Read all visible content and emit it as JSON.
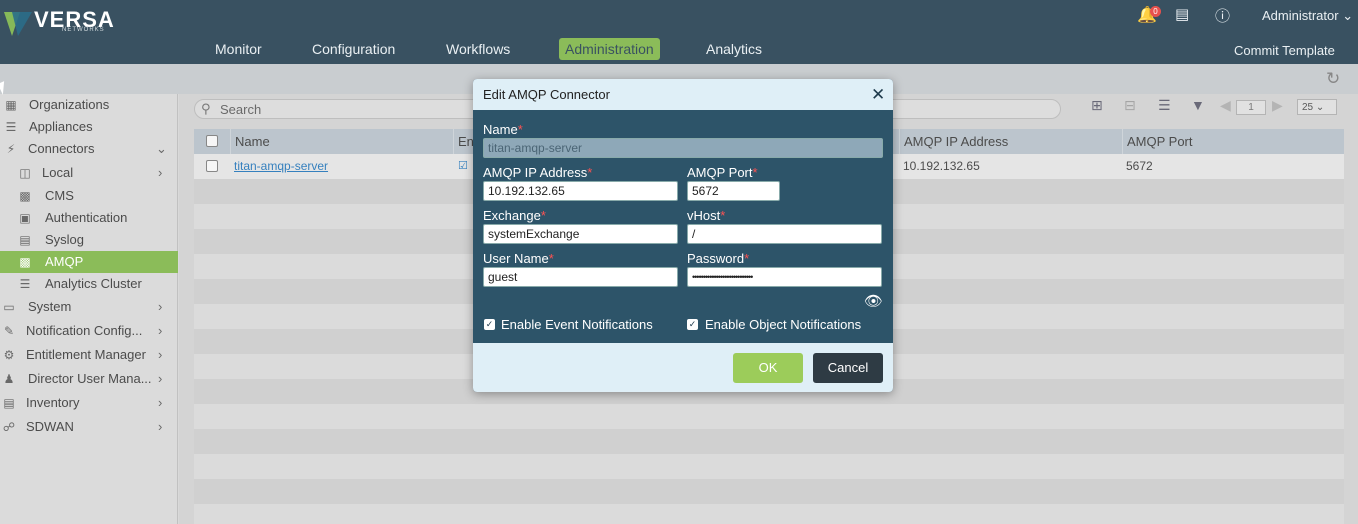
{
  "brand": {
    "name": "VERSA",
    "sub": "NETWORKS",
    "colors": {
      "primary": "#1e3a4c",
      "accent": "#7cb342",
      "logo_green": "#76b043",
      "logo_dark": "#0d5a7a"
    }
  },
  "nav": {
    "items": [
      "Monitor",
      "Configuration",
      "Workflows",
      "Administration",
      "Analytics"
    ],
    "active": "Administration"
  },
  "header": {
    "notification_count": "0",
    "user": "Administrator",
    "commit": "Commit Template"
  },
  "sidebar": {
    "items": [
      {
        "label": "Organizations",
        "icon": "organizations-icon",
        "level": 0
      },
      {
        "label": "Appliances",
        "icon": "appliances-icon",
        "level": 0
      },
      {
        "label": "Connectors",
        "icon": "connectors-icon",
        "level": 0,
        "expanded": true
      },
      {
        "label": "Local",
        "icon": "local-icon",
        "level": 1
      },
      {
        "label": "CMS",
        "icon": "cms-icon",
        "level": 1
      },
      {
        "label": "Authentication",
        "icon": "authentication-icon",
        "level": 1
      },
      {
        "label": "Syslog",
        "icon": "syslog-icon",
        "level": 1
      },
      {
        "label": "AMQP",
        "icon": "amqp-icon",
        "level": 1,
        "active": true
      },
      {
        "label": "Analytics Cluster",
        "icon": "analytics-cluster-icon",
        "level": 1
      },
      {
        "label": "System",
        "icon": "system-icon",
        "level": 0
      },
      {
        "label": "Notification Config...",
        "icon": "notification-config-icon",
        "level": 0
      },
      {
        "label": "Entitlement Manager",
        "icon": "entitlement-icon",
        "level": 0
      },
      {
        "label": "Director User Mana...",
        "icon": "director-user-icon",
        "level": 0
      },
      {
        "label": "Inventory",
        "icon": "inventory-icon",
        "level": 0
      },
      {
        "label": "SDWAN",
        "icon": "sdwan-icon",
        "level": 0
      }
    ]
  },
  "search": {
    "placeholder": "Search"
  },
  "pagination": {
    "page": "1",
    "page_size": "25"
  },
  "table": {
    "columns": [
      "Name",
      "Ena",
      "AMQP IP Address",
      "AMQP Port"
    ],
    "rows": [
      {
        "name": "titan-amqp-server",
        "ip": "10.192.132.65",
        "port": "5672"
      }
    ]
  },
  "modal": {
    "title": "Edit AMQP Connector",
    "fields": {
      "name": {
        "label": "Name",
        "value": "titan-amqp-server"
      },
      "ip": {
        "label": "AMQP IP Address",
        "value": "10.192.132.65"
      },
      "port": {
        "label": "AMQP Port",
        "value": "5672"
      },
      "exchange": {
        "label": "Exchange",
        "value": "systemExchange"
      },
      "vhost": {
        "label": "vHost",
        "value": "/"
      },
      "username": {
        "label": "User Name",
        "value": "guest"
      },
      "password": {
        "label": "Password",
        "value": "••••••••••••••••••••••••••••"
      }
    },
    "required_mark": "*",
    "checkboxes": {
      "event": {
        "label": "Enable Event Notifications",
        "checked": true
      },
      "object": {
        "label": "Enable Object Notifications",
        "checked": true
      }
    },
    "ok": "OK",
    "cancel": "Cancel"
  }
}
